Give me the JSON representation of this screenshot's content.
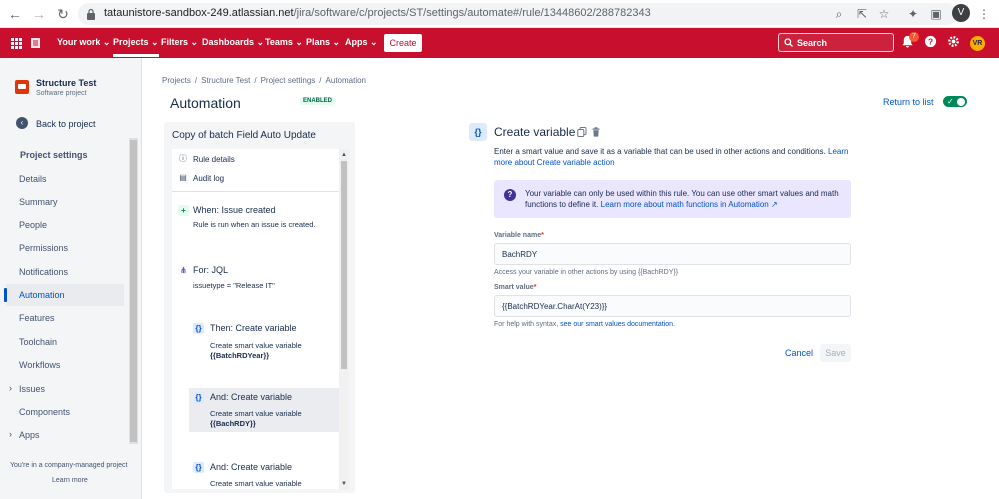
{
  "browser": {
    "url_host": "tataunistore-sandbox-249.atlassian.net",
    "url_path": "/jira/software/c/projects/ST/settings/automate#/rule/13448602/288782343",
    "profile_initial": "V"
  },
  "topnav": {
    "your_work": "Your work",
    "projects": "Projects",
    "filters": "Filters",
    "dashboards": "Dashboards",
    "teams": "Teams",
    "plans": "Plans",
    "apps": "Apps",
    "create": "Create",
    "search_placeholder": "Search",
    "notification_count": "7",
    "avatar_initials": "VR",
    "brand_color": "#c8102e"
  },
  "sidebar": {
    "project_name": "Structure Test",
    "project_type": "Software project",
    "back_label": "Back to project",
    "heading": "Project settings",
    "items": [
      {
        "label": "Details"
      },
      {
        "label": "Summary"
      },
      {
        "label": "People"
      },
      {
        "label": "Permissions"
      },
      {
        "label": "Notifications"
      },
      {
        "label": "Automation"
      },
      {
        "label": "Features"
      },
      {
        "label": "Toolchain"
      },
      {
        "label": "Workflows"
      },
      {
        "label": "Issues"
      },
      {
        "label": "Components"
      },
      {
        "label": "Apps"
      }
    ],
    "footer_text": "You're in a company-managed project",
    "footer_link": "Learn more"
  },
  "breadcrumb": {
    "items": [
      "Projects",
      "Structure Test",
      "Project settings",
      "Automation"
    ]
  },
  "header": {
    "title": "Automation",
    "status": "ENABLED",
    "return_link": "Return to list"
  },
  "rule": {
    "title": "Copy of batch Field Auto Update",
    "rule_details": "Rule details",
    "audit_log": "Audit log",
    "trigger_title": "When: Issue created",
    "trigger_desc": "Rule is run when an issue is created.",
    "for_title": "For: JQL",
    "for_desc": "issuetype = \"Release IT\"",
    "actions": [
      {
        "title": "Then: Create variable",
        "desc": "Create smart value variable",
        "value": "{{BatchRDYear}}"
      },
      {
        "title": "And: Create variable",
        "desc": "Create smart value variable",
        "value": "{{BachRDY}}"
      },
      {
        "title": "And: Create variable",
        "desc": "Create smart value variable"
      }
    ]
  },
  "config": {
    "title": "Create variable",
    "desc_text": "Enter a smart value and save it as a variable that can be used in other actions and conditions.",
    "desc_link": "Learn more about Create variable action",
    "info_text": "Your variable can only be used within this rule. You can use other smart values and math functions to define it.",
    "info_link": "Learn more about math functions in Automation ↗",
    "var_name_label": "Variable name",
    "var_name_value": "BachRDY",
    "var_name_help": "Access your variable in other actions by using {{BachRDY}}",
    "smart_value_label": "Smart value",
    "smart_value_value": "{{BatchRDYear.CharAt(Y23)}}",
    "smart_help_text": "For help with syntax,",
    "smart_help_link": "see our smart values documentation.",
    "cancel": "Cancel",
    "save": "Save"
  }
}
